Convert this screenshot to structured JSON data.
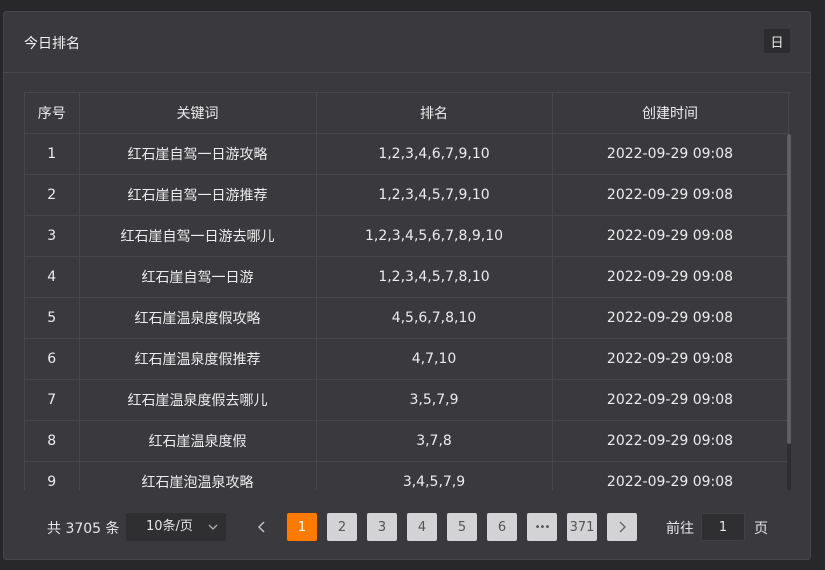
{
  "panel": {
    "title": "今日排名",
    "period_button": "日"
  },
  "table": {
    "columns": [
      "序号",
      "关键词",
      "排名",
      "创建时间"
    ],
    "rows": [
      [
        "1",
        "红石崖自驾一日游攻略",
        "1,2,3,4,6,7,9,10",
        "2022-09-29 09:08"
      ],
      [
        "2",
        "红石崖自驾一日游推荐",
        "1,2,3,4,5,7,9,10",
        "2022-09-29 09:08"
      ],
      [
        "3",
        "红石崖自驾一日游去哪儿",
        "1,2,3,4,5,6,7,8,9,10",
        "2022-09-29 09:08"
      ],
      [
        "4",
        "红石崖自驾一日游",
        "1,2,3,4,5,7,8,10",
        "2022-09-29 09:08"
      ],
      [
        "5",
        "红石崖温泉度假攻略",
        "4,5,6,7,8,10",
        "2022-09-29 09:08"
      ],
      [
        "6",
        "红石崖温泉度假推荐",
        "4,7,10",
        "2022-09-29 09:08"
      ],
      [
        "7",
        "红石崖温泉度假去哪儿",
        "3,5,7,9",
        "2022-09-29 09:08"
      ],
      [
        "8",
        "红石崖温泉度假",
        "3,7,8",
        "2022-09-29 09:08"
      ],
      [
        "9",
        "红石崖泡温泉攻略",
        "3,4,5,7,9",
        "2022-09-29 09:08"
      ]
    ]
  },
  "pagination": {
    "total_text": "共 3705 条",
    "page_size": "10条/页",
    "prev_icon": "chevron-left-icon",
    "next_icon": "chevron-right-icon",
    "pages": [
      "1",
      "2",
      "3",
      "4",
      "5",
      "6",
      "•••",
      "371"
    ],
    "current_page": "1",
    "goto_label": "前往",
    "goto_value": "1",
    "goto_suffix": "页",
    "accent_color": "#ff7a00"
  }
}
